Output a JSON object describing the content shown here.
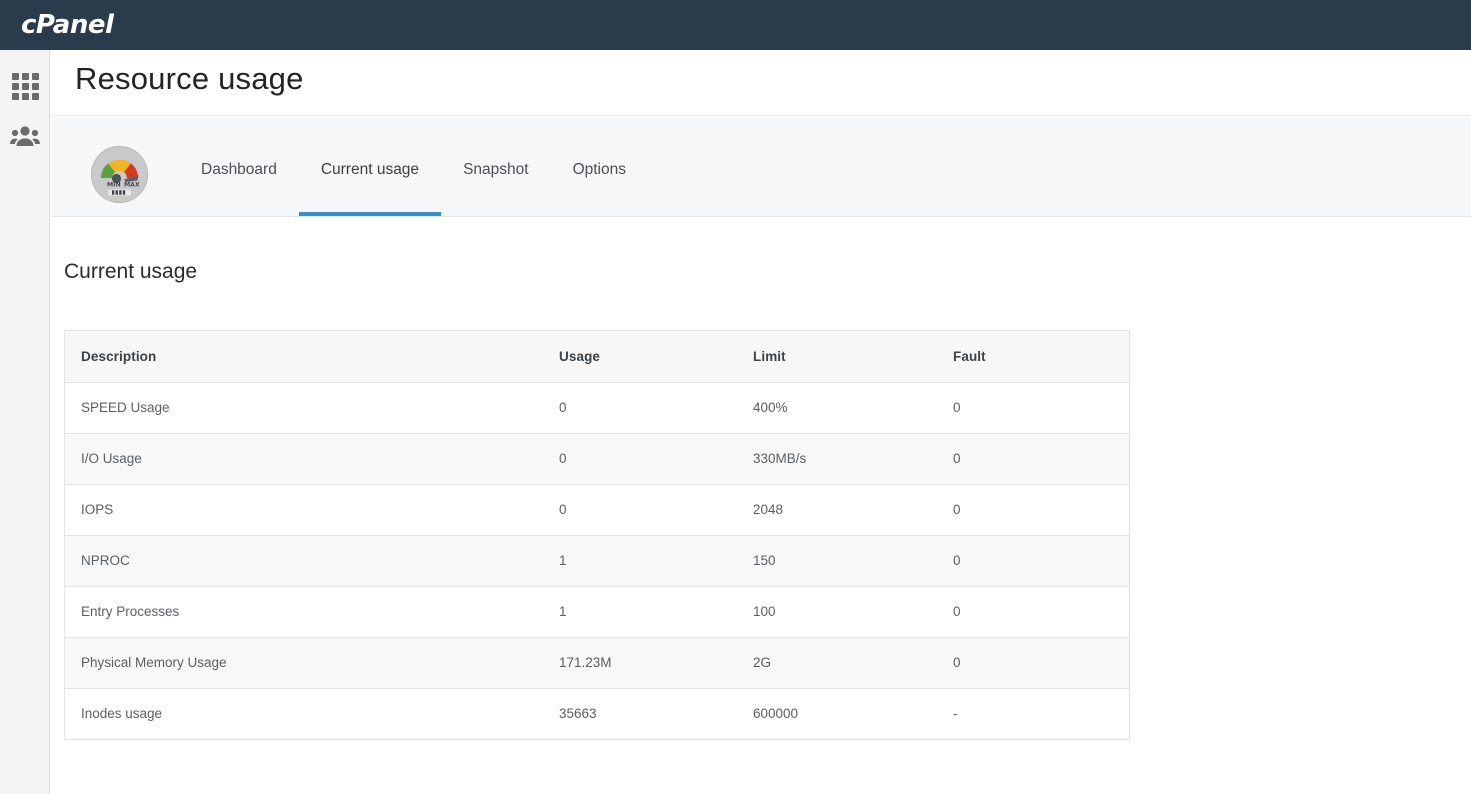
{
  "topbar": {
    "brand": "cPanel"
  },
  "rail": {
    "items": [
      {
        "name": "apps-grid-icon",
        "label": ""
      },
      {
        "name": "users-icon",
        "label": ""
      }
    ]
  },
  "page": {
    "title": "Resource usage",
    "section_title": "Current usage"
  },
  "tabs": [
    {
      "label": "Dashboard",
      "active": false
    },
    {
      "label": "Current usage",
      "active": true
    },
    {
      "label": "Snapshot",
      "active": false
    },
    {
      "label": "Options",
      "active": false
    }
  ],
  "gauge": {
    "min_label": "MIN",
    "max_label": "MAX"
  },
  "table": {
    "headers": [
      "Description",
      "Usage",
      "Limit",
      "Fault"
    ],
    "rows": [
      {
        "description": "SPEED Usage",
        "usage": "0",
        "limit": "400%",
        "fault": "0"
      },
      {
        "description": "I/O Usage",
        "usage": "0",
        "limit": "330MB/s",
        "fault": "0"
      },
      {
        "description": "IOPS",
        "usage": "0",
        "limit": "2048",
        "fault": "0"
      },
      {
        "description": "NPROC",
        "usage": "1",
        "limit": "150",
        "fault": "0"
      },
      {
        "description": "Entry Processes",
        "usage": "1",
        "limit": "100",
        "fault": "0"
      },
      {
        "description": "Physical Memory Usage",
        "usage": "171.23M",
        "limit": "2G",
        "fault": "0"
      },
      {
        "description": "Inodes usage",
        "usage": "35663",
        "limit": "600000",
        "fault": "-"
      }
    ]
  },
  "colors": {
    "topbar_bg": "#2a3c4b",
    "accent": "#3493ce",
    "rail_bg": "#f4f4f4",
    "tabstrip_bg": "#f6f7f8",
    "row_alt_bg": "#f8f8f8"
  }
}
